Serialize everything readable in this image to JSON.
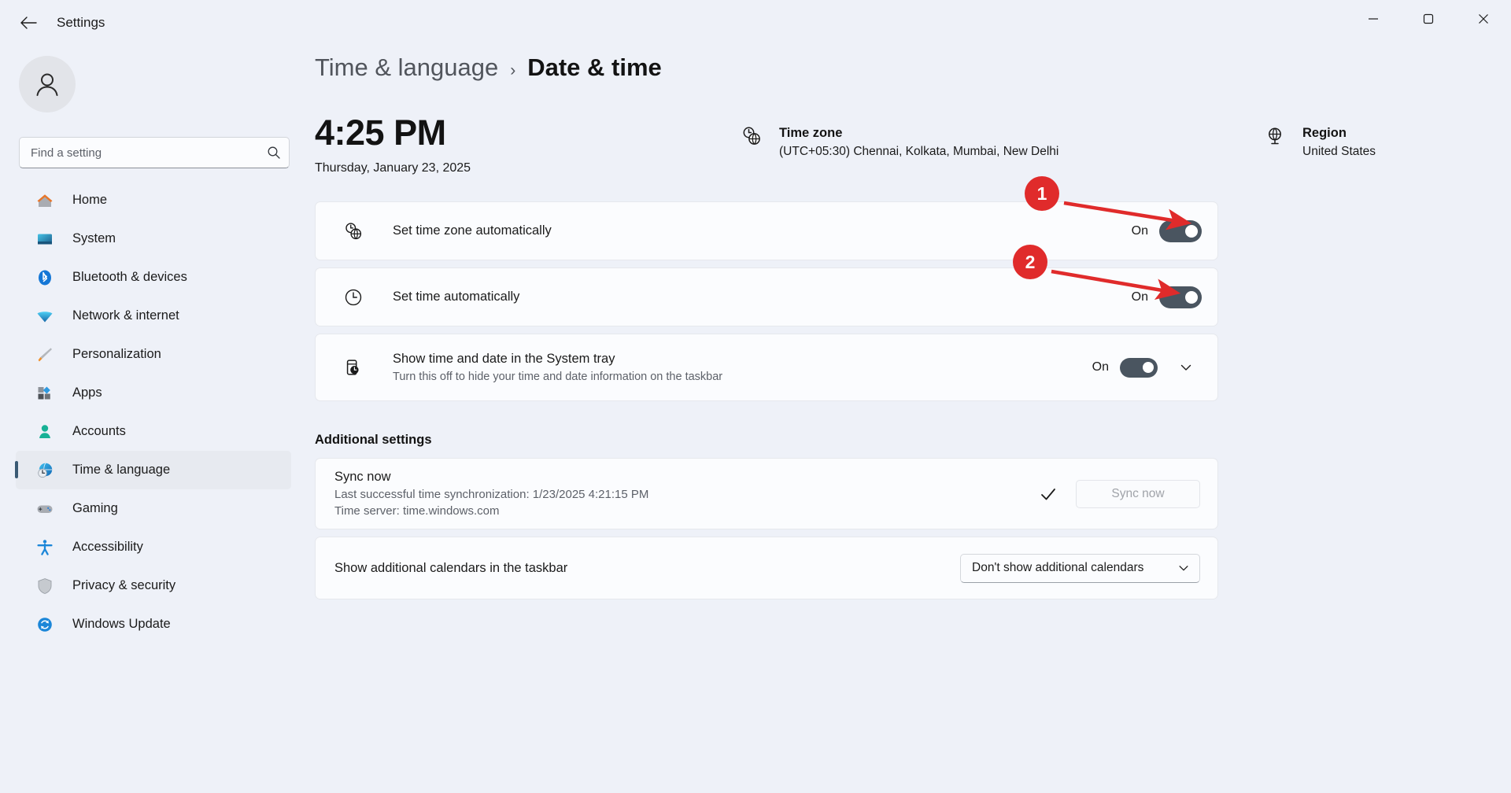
{
  "window": {
    "title": "Settings",
    "back_icon": "back-arrow-icon",
    "minimize_icon": "minimize-icon",
    "maximize_icon": "maximize-icon",
    "close_icon": "close-icon"
  },
  "sidebar": {
    "avatar_icon": "user-avatar-icon",
    "search": {
      "placeholder": "Find a setting",
      "value": "",
      "icon": "search-icon"
    },
    "items": [
      {
        "label": "Home",
        "icon": "home-icon",
        "selected": false
      },
      {
        "label": "System",
        "icon": "system-icon",
        "selected": false
      },
      {
        "label": "Bluetooth & devices",
        "icon": "bluetooth-icon",
        "selected": false
      },
      {
        "label": "Network & internet",
        "icon": "network-icon",
        "selected": false
      },
      {
        "label": "Personalization",
        "icon": "paintbrush-icon",
        "selected": false
      },
      {
        "label": "Apps",
        "icon": "apps-icon",
        "selected": false
      },
      {
        "label": "Accounts",
        "icon": "accounts-icon",
        "selected": false
      },
      {
        "label": "Time & language",
        "icon": "time-language-icon",
        "selected": true
      },
      {
        "label": "Gaming",
        "icon": "gamepad-icon",
        "selected": false
      },
      {
        "label": "Accessibility",
        "icon": "accessibility-icon",
        "selected": false
      },
      {
        "label": "Privacy & security",
        "icon": "shield-icon",
        "selected": false
      },
      {
        "label": "Windows Update",
        "icon": "update-icon",
        "selected": false
      }
    ]
  },
  "main": {
    "breadcrumb": {
      "parent": "Time & language",
      "separator": "›",
      "current": "Date & time"
    },
    "clock": {
      "time": "4:25 PM",
      "date": "Thursday, January 23, 2025"
    },
    "timezone": {
      "icon": "clock-globe-icon",
      "title": "Time zone",
      "value": "(UTC+05:30) Chennai, Kolkata, Mumbai, New Delhi"
    },
    "region": {
      "icon": "globe-icon",
      "title": "Region",
      "value": "United States"
    },
    "settings_cards": [
      {
        "icon": "clock-globe-icon",
        "title": "Set time zone automatically",
        "subtitle": "",
        "state_label": "On",
        "toggle_on": true,
        "has_chevron": false
      },
      {
        "icon": "clock-icon",
        "title": "Set time automatically",
        "subtitle": "",
        "state_label": "On",
        "toggle_on": true,
        "has_chevron": false
      },
      {
        "icon": "taskbar-clock-icon",
        "title": "Show time and date in the System tray",
        "subtitle": "Turn this off to hide your time and date information on the taskbar",
        "state_label": "On",
        "toggle_on": true,
        "has_chevron": true,
        "chevron_icon": "chevron-down-icon"
      }
    ],
    "additional_settings": {
      "heading": "Additional settings",
      "sync": {
        "title": "Sync now",
        "last_sync": "Last successful time synchronization: 1/23/2025 4:21:15 PM",
        "time_server": "Time server: time.windows.com",
        "check_icon": "checkmark-icon",
        "button_label": "Sync now",
        "button_disabled": true
      },
      "calendars": {
        "label": "Show additional calendars in the taskbar",
        "selected_option": "Don't show additional calendars",
        "chevron_icon": "chevron-down-icon"
      }
    }
  },
  "annotations": {
    "color": "#e02b2b",
    "markers": [
      {
        "number": "1",
        "target": "set-time-zone-automatically-toggle"
      },
      {
        "number": "2",
        "target": "set-time-automatically-toggle"
      }
    ]
  }
}
